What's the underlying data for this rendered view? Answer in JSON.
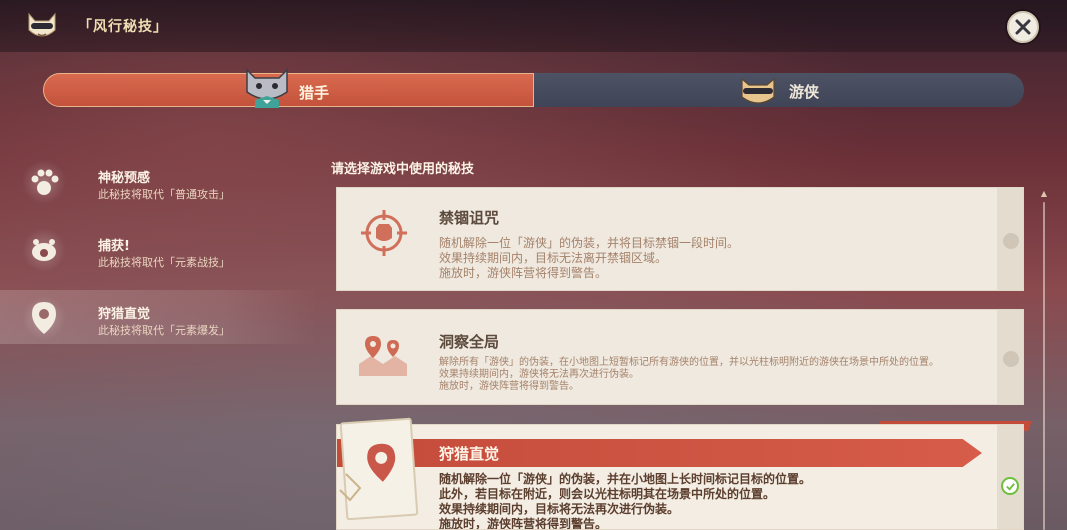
{
  "header": {
    "title": "「风行秘技」",
    "app_icon": "cat-mask-icon",
    "close_icon": "close-icon"
  },
  "role_tabs": [
    {
      "label": "猎手",
      "icon": "hunter-cat-avatar",
      "selected": true
    },
    {
      "label": "游侠",
      "icon": "ranger-cat-avatar",
      "selected": false
    }
  ],
  "skills": [
    {
      "name": "神秘预感",
      "desc": "此秘技将取代「普通攻击」",
      "icon": "paw-print-icon"
    },
    {
      "name": "捕获!",
      "desc": "此秘技将取代「元素战技」",
      "icon": "cat-paw-icon"
    },
    {
      "name": "狩猎直觉",
      "desc": "此秘技将取代「元素爆发」",
      "icon": "location-pin-icon",
      "selected": true
    }
  ],
  "main": {
    "section_title": "请选择游戏中使用的秘技",
    "cards": [
      {
        "title": "禁锢诅咒",
        "lines": [
          "随机解除一位「游侠」的伪装，并将目标禁锢一段时间。",
          "效果持续期间内，目标无法离开禁锢区域。",
          "施放时，游侠阵营将得到警告。"
        ],
        "icon": "crosshair-cat-icon",
        "selected": false
      },
      {
        "title": "洞察全局",
        "lines": [
          "解除所有「游侠」的伪装，在小地图上短暂标记所有游侠的位置，并以光柱标明附近的游侠在场景中所处的位置。",
          "效果持续期间内，游侠将无法再次进行伪装。",
          "施放时，游侠阵营将得到警告。"
        ],
        "icon": "map-pins-icon",
        "selected": false
      },
      {
        "title": "狩猎直觉",
        "lines": [
          "随机解除一位「游侠」的伪装，并在小地图上长时间标记目标的位置。",
          "此外，若目标在附近，则会以光柱标明其在场景中所处的位置。",
          "效果持续期间内，目标将无法再次进行伪装。",
          "施放时，游侠阵营将得到警告。"
        ],
        "icon": "location-pin-icon",
        "selected": true
      }
    ]
  },
  "colors": {
    "accent_red": "#c44a3a",
    "tab_inactive": "#43485a",
    "card_bg": "#efe9df",
    "check_green": "#6fbf3f"
  }
}
